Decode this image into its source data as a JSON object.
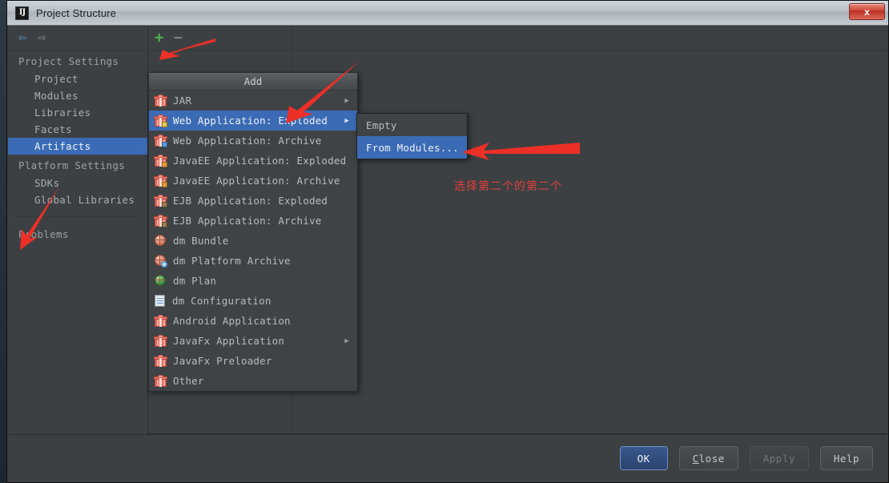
{
  "window": {
    "title": "Project Structure",
    "app_icon": "IJ",
    "close_label": "x"
  },
  "nav": {
    "back_icon": "⇦",
    "forward_icon": "⇨"
  },
  "sidebar": {
    "groups": [
      {
        "header": "Project Settings",
        "items": [
          {
            "label": "Project",
            "selected": false
          },
          {
            "label": "Modules",
            "selected": false
          },
          {
            "label": "Libraries",
            "selected": false
          },
          {
            "label": "Facets",
            "selected": false
          },
          {
            "label": "Artifacts",
            "selected": true
          }
        ]
      },
      {
        "header": "Platform Settings",
        "items": [
          {
            "label": "SDKs",
            "selected": false
          },
          {
            "label": "Global Libraries",
            "selected": false
          }
        ]
      }
    ],
    "problems": "Problems"
  },
  "toolbar": {
    "add_icon": "+",
    "remove_icon": "−"
  },
  "menu": {
    "title": "Add",
    "items": [
      {
        "label": "JAR",
        "icon": "gift",
        "badge": "",
        "submenu": true,
        "selected": false
      },
      {
        "label": "Web Application: Exploded",
        "icon": "gift",
        "badge": "yellow",
        "submenu": true,
        "selected": true
      },
      {
        "label": "Web Application: Archive",
        "icon": "gift",
        "badge": "blue",
        "submenu": false,
        "selected": false
      },
      {
        "label": "JavaEE Application: Exploded",
        "icon": "gift",
        "badge": "orange",
        "submenu": false,
        "selected": false
      },
      {
        "label": "JavaEE Application: Archive",
        "icon": "gift",
        "badge": "orange",
        "submenu": false,
        "selected": false
      },
      {
        "label": "EJB Application: Exploded",
        "icon": "gift",
        "badge": "brown",
        "submenu": false,
        "selected": false
      },
      {
        "label": "EJB Application: Archive",
        "icon": "gift",
        "badge": "brown",
        "submenu": false,
        "selected": false
      },
      {
        "label": "dm Bundle",
        "icon": "dm-sphere",
        "badge": "",
        "submenu": false,
        "selected": false
      },
      {
        "label": "dm Platform Archive",
        "icon": "dm-sphere-mag",
        "badge": "",
        "submenu": false,
        "selected": false
      },
      {
        "label": "dm Plan",
        "icon": "dm-globe",
        "badge": "",
        "submenu": false,
        "selected": false
      },
      {
        "label": "dm Configuration",
        "icon": "document",
        "badge": "",
        "submenu": false,
        "selected": false
      },
      {
        "label": "Android Application",
        "icon": "gift",
        "badge": "",
        "submenu": false,
        "selected": false
      },
      {
        "label": "JavaFx Application",
        "icon": "gift",
        "badge": "",
        "submenu": true,
        "selected": false
      },
      {
        "label": "JavaFx Preloader",
        "icon": "gift",
        "badge": "",
        "submenu": false,
        "selected": false
      },
      {
        "label": "Other",
        "icon": "gift",
        "badge": "",
        "submenu": false,
        "selected": false
      }
    ],
    "submenu_arrow": "▶"
  },
  "submenu": {
    "items": [
      {
        "label": "Empty",
        "selected": false
      },
      {
        "label": "From Modules...",
        "selected": true
      }
    ]
  },
  "annotation": {
    "text": "选择第二个的第二个",
    "color": "#e0403a"
  },
  "footer": {
    "buttons": [
      {
        "label": "OK",
        "style": "primary",
        "mnemonic": ""
      },
      {
        "label": "Close",
        "style": "normal",
        "mnemonic": "C"
      },
      {
        "label": "Apply",
        "style": "disabled",
        "mnemonic": ""
      },
      {
        "label": "Help",
        "style": "normal",
        "mnemonic": ""
      }
    ]
  },
  "colors": {
    "accent_selection": "#3b6bb5",
    "window_bg": "#3c4043",
    "menu_bg": "#3f4346",
    "annotation_red": "#e0403a",
    "add_icon_green": "#4caf50"
  }
}
